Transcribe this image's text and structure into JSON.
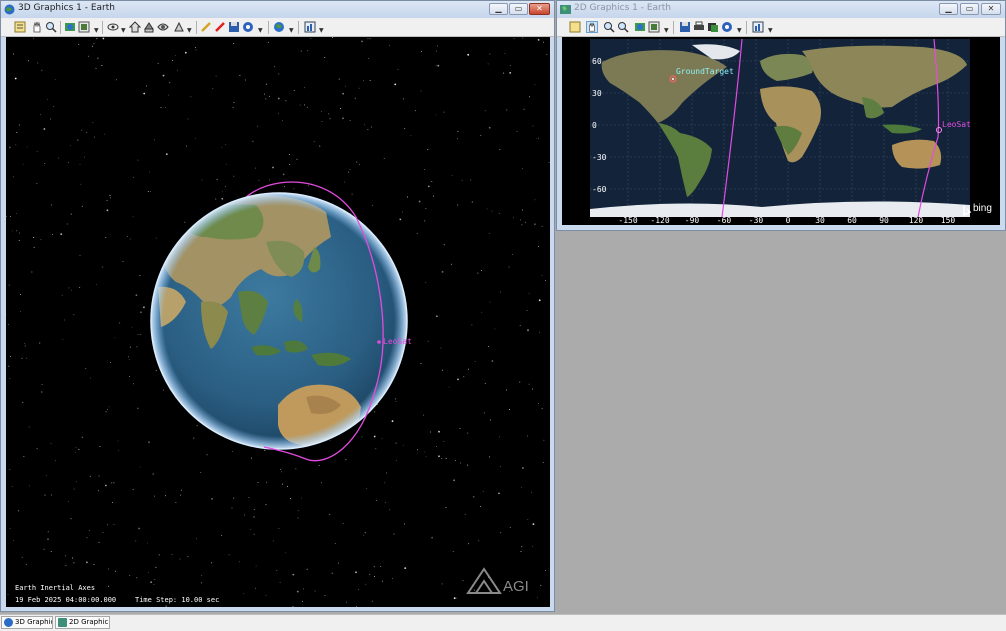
{
  "win3d": {
    "title": "3D Graphics 1 - Earth",
    "overlay": {
      "axes": "Earth Inertial Axes",
      "datetime": "19 Feb 2025 04:00:00.000",
      "timestep": "Time Step: 10.00 sec"
    },
    "satellite_label": "LeoSat",
    "watermark": "AGI"
  },
  "win2d": {
    "title": "2D Graphics 1 - Earth",
    "ground_target_label": "GroundTarget",
    "satellite_label": "LeoSat",
    "lat_ticks": [
      "60",
      "30",
      "0",
      "-30",
      "-60"
    ],
    "lon_ticks": [
      "-150",
      "-120",
      "-90",
      "-60",
      "-30",
      "0",
      "30",
      "60",
      "90",
      "120",
      "150"
    ],
    "map_attribution": "bing"
  },
  "taskbar": {
    "items": [
      "3D Graphic...",
      "2D Graphic..."
    ]
  },
  "colors": {
    "orbit": "#e24be0",
    "target_label": "#8ff0f4",
    "space": "#000000"
  }
}
